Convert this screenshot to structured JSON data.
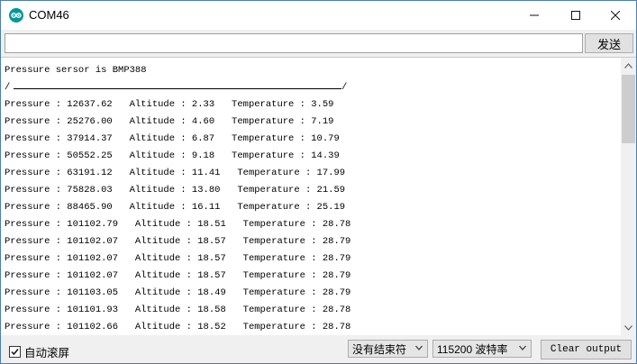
{
  "window": {
    "title": "COM46",
    "icon": "arduino-icon",
    "controls": [
      "minimize-icon",
      "maximize-icon",
      "close-icon"
    ]
  },
  "send_bar": {
    "input_value": "",
    "send_label": "发送"
  },
  "output": {
    "header": "Pressure sersor is BMP388",
    "divider_start": "/",
    "divider_end": "/",
    "lines": [
      "Pressure : 12637.62   Altitude : 2.33   Temperature : 3.59",
      "Pressure : 25276.00   Altitude : 4.60   Temperature : 7.19",
      "Pressure : 37914.37   Altitude : 6.87   Temperature : 10.79",
      "Pressure : 50552.25   Altitude : 9.18   Temperature : 14.39",
      "Pressure : 63191.12   Altitude : 11.41   Temperature : 17.99",
      "Pressure : 75828.03   Altitude : 13.80   Temperature : 21.59",
      "Pressure : 88465.90   Altitude : 16.11   Temperature : 25.19",
      "Pressure : 101102.79   Altitude : 18.51   Temperature : 28.78",
      "Pressure : 101102.07   Altitude : 18.57   Temperature : 28.79",
      "Pressure : 101102.07   Altitude : 18.57   Temperature : 28.79",
      "Pressure : 101102.07   Altitude : 18.57   Temperature : 28.79",
      "Pressure : 101103.05   Altitude : 18.49   Temperature : 28.79",
      "Pressure : 101101.93   Altitude : 18.58   Temperature : 28.78",
      "Pressure : 101102.66   Altitude : 18.52   Temperature : 28.78"
    ]
  },
  "bottom": {
    "autoscroll_label": "自动滚屏",
    "autoscroll_checked": true,
    "line_ending": "没有结束符",
    "baud_rate": "115200 波特率",
    "clear_label": "Clear output"
  }
}
